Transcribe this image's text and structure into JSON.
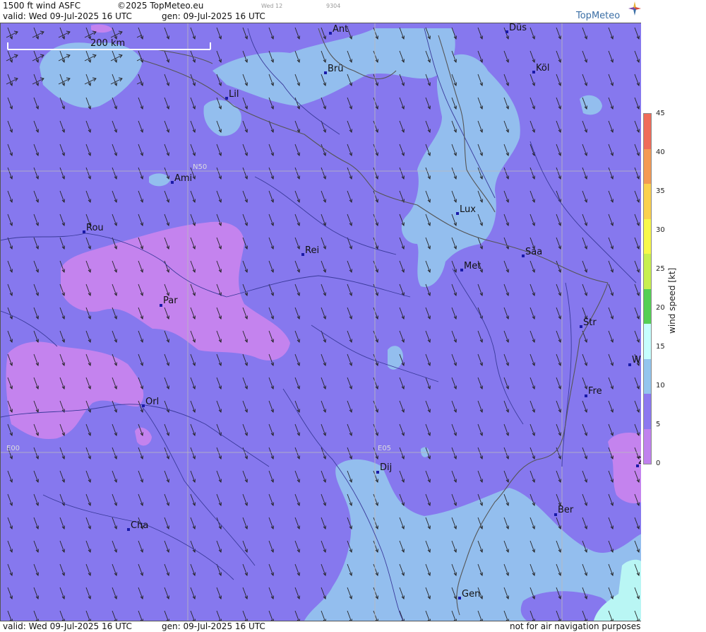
{
  "header": {
    "product": "1500 ft wind ASFC",
    "copyright": "©2025 TopMeteo.eu",
    "day_tag": "Wed 12",
    "code_tag": "9304",
    "valid": "valid:  Wed  09-Jul-2025  16 UTC",
    "generated": "gen: 09-Jul-2025 16 UTC",
    "logo": "TopMeteo"
  },
  "scale_bar": {
    "label": "200 km"
  },
  "grid_labels": {
    "lat": "N50",
    "lon_west": "E00",
    "lon_east": "E05"
  },
  "cities": [
    {
      "name": "Ant"
    },
    {
      "name": "Düs"
    },
    {
      "name": "Brü"
    },
    {
      "name": "Köl"
    },
    {
      "name": "Lil"
    },
    {
      "name": "Ami"
    },
    {
      "name": "Rou"
    },
    {
      "name": "Lux"
    },
    {
      "name": "Rei"
    },
    {
      "name": "Saa"
    },
    {
      "name": "Met"
    },
    {
      "name": "Par"
    },
    {
      "name": "Str"
    },
    {
      "name": "W"
    },
    {
      "name": "Fre"
    },
    {
      "name": "Orl"
    },
    {
      "name": "Dij"
    },
    {
      "name": "Z"
    },
    {
      "name": "Ber"
    },
    {
      "name": "Cha"
    },
    {
      "name": "Gen"
    }
  ],
  "footer": {
    "valid": "valid:  Wed  09-Jul-2025  16 UTC",
    "generated": "gen: 09-Jul-2025 16 UTC",
    "disclaimer": "not for air navigation purposes"
  },
  "legend": {
    "title": "wind speed [kt]",
    "ticks": [
      "45",
      "40",
      "35",
      "30",
      "25",
      "20",
      "15",
      "10",
      "5",
      "0"
    ],
    "colors": [
      "#ef6c5a",
      "#f49a55",
      "#fbd14e",
      "#f8f84a",
      "#c8ef50",
      "#8fe15a",
      "#55cf55",
      "#c6fefe",
      "#93c5ee",
      "#8c78f0",
      "#c081ee"
    ]
  },
  "map_colors": {
    "base": "#8678ee",
    "light": "#93beee",
    "pink": "#c483ee",
    "cyan": "#b9f6f4"
  }
}
